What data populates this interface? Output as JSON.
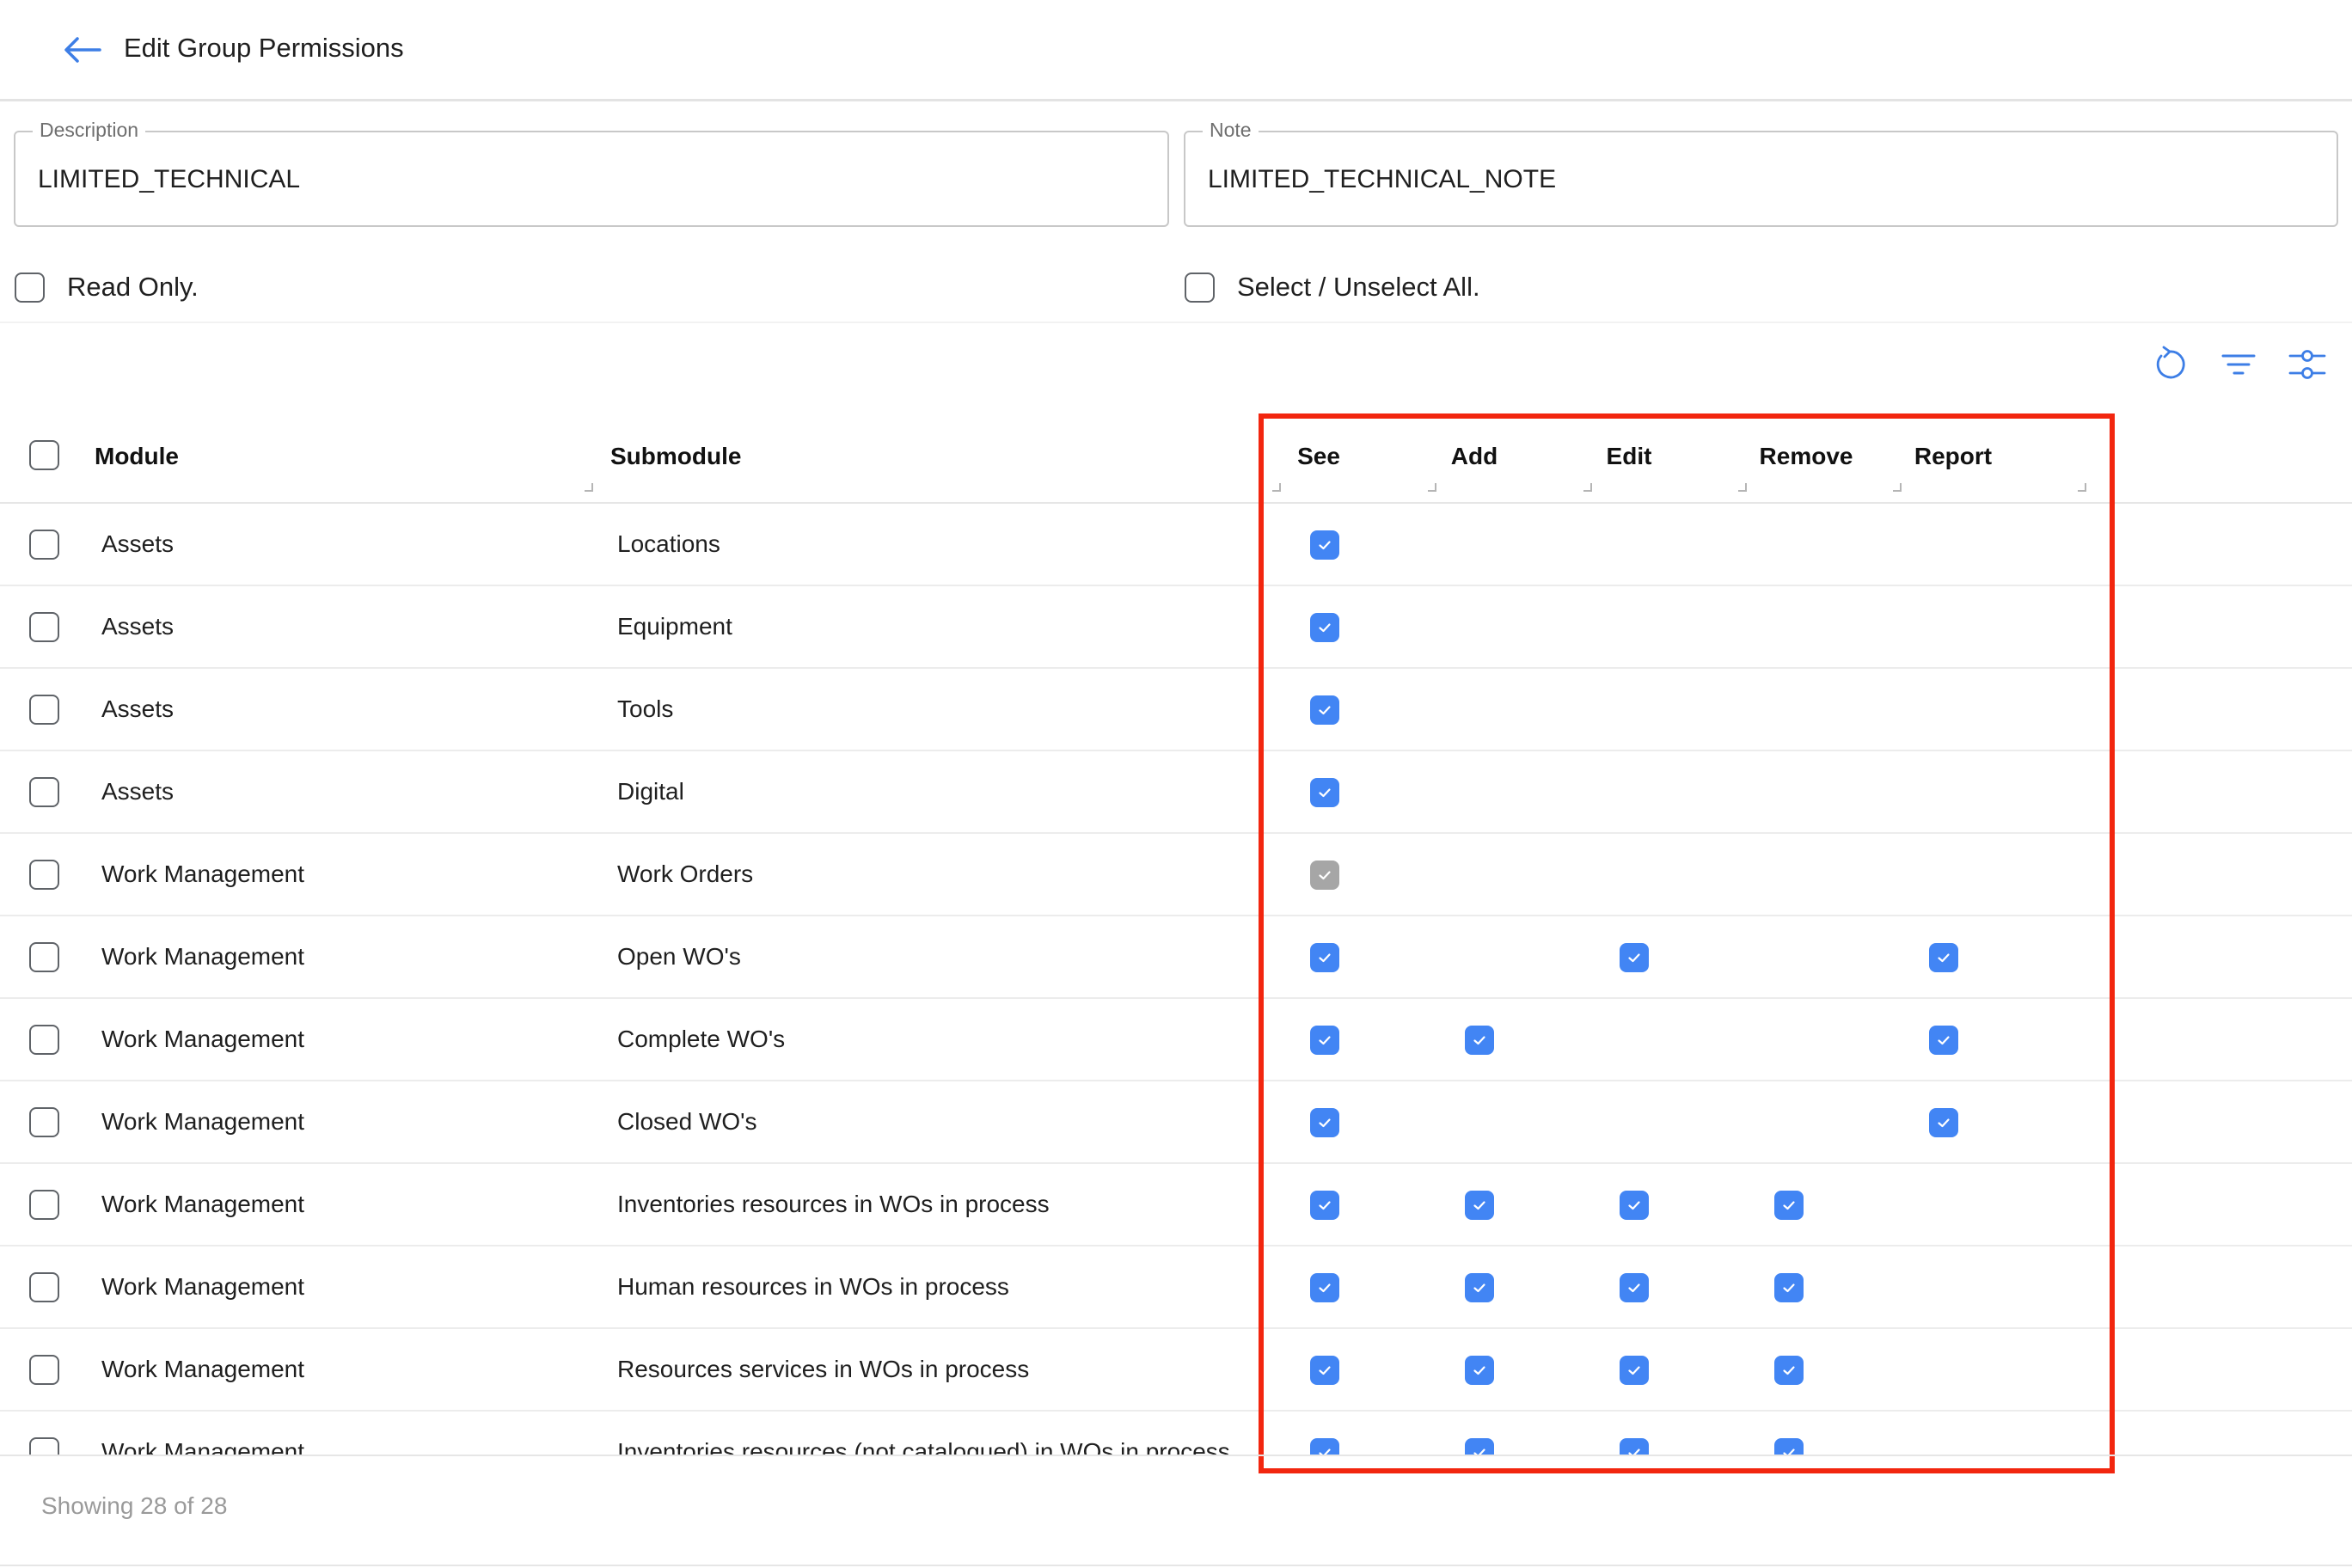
{
  "header": {
    "title": "Edit Group Permissions",
    "back_icon": "arrow-left-icon"
  },
  "form": {
    "description": {
      "label": "Description",
      "value": "LIMITED_TECHNICAL"
    },
    "note": {
      "label": "Note",
      "value": "LIMITED_TECHNICAL_NOTE"
    }
  },
  "options": {
    "read_only": {
      "label": "Read Only.",
      "checked": false
    },
    "select_all": {
      "label": "Select / Unselect All.",
      "checked": false
    }
  },
  "toolbar": {
    "icons": [
      "refresh-icon",
      "filter-icon",
      "column-settings-icon"
    ]
  },
  "table": {
    "columns": {
      "module": "Module",
      "submodule": "Submodule",
      "see": "See",
      "add": "Add",
      "edit": "Edit",
      "remove": "Remove",
      "report": "Report"
    },
    "rows": [
      {
        "module": "Assets",
        "submodule": "Locations",
        "see": true,
        "see_disabled": false,
        "add": false,
        "edit": false,
        "remove": false,
        "report": false
      },
      {
        "module": "Assets",
        "submodule": "Equipment",
        "see": true,
        "see_disabled": false,
        "add": false,
        "edit": false,
        "remove": false,
        "report": false
      },
      {
        "module": "Assets",
        "submodule": "Tools",
        "see": true,
        "see_disabled": false,
        "add": false,
        "edit": false,
        "remove": false,
        "report": false
      },
      {
        "module": "Assets",
        "submodule": "Digital",
        "see": true,
        "see_disabled": false,
        "add": false,
        "edit": false,
        "remove": false,
        "report": false
      },
      {
        "module": "Work Management",
        "submodule": "Work Orders",
        "see": true,
        "see_disabled": true,
        "add": false,
        "edit": false,
        "remove": false,
        "report": false
      },
      {
        "module": "Work Management",
        "submodule": "Open WO's",
        "see": true,
        "see_disabled": false,
        "add": false,
        "edit": true,
        "remove": false,
        "report": true
      },
      {
        "module": "Work Management",
        "submodule": "Complete WO's",
        "see": true,
        "see_disabled": false,
        "add": true,
        "edit": false,
        "remove": false,
        "report": true
      },
      {
        "module": "Work Management",
        "submodule": "Closed WO's",
        "see": true,
        "see_disabled": false,
        "add": false,
        "edit": false,
        "remove": false,
        "report": true
      },
      {
        "module": "Work Management",
        "submodule": "Inventories resources in WOs in process",
        "see": true,
        "see_disabled": false,
        "add": true,
        "edit": true,
        "remove": true,
        "report": false
      },
      {
        "module": "Work Management",
        "submodule": "Human resources in WOs in process",
        "see": true,
        "see_disabled": false,
        "add": true,
        "edit": true,
        "remove": true,
        "report": false
      },
      {
        "module": "Work Management",
        "submodule": "Resources services in WOs in process",
        "see": true,
        "see_disabled": false,
        "add": true,
        "edit": true,
        "remove": true,
        "report": false
      },
      {
        "module": "Work Management",
        "submodule": "Inventories resources (not catalogued) in WOs in process",
        "see": true,
        "see_disabled": false,
        "add": true,
        "edit": true,
        "remove": true,
        "report": false
      }
    ]
  },
  "footer": {
    "showing": "Showing 28 of 28"
  },
  "colors": {
    "accent": "#3d7ee6",
    "checked": "#4285f4",
    "disabled_checked": "#a6a6a6",
    "highlight": "#f2260f"
  }
}
